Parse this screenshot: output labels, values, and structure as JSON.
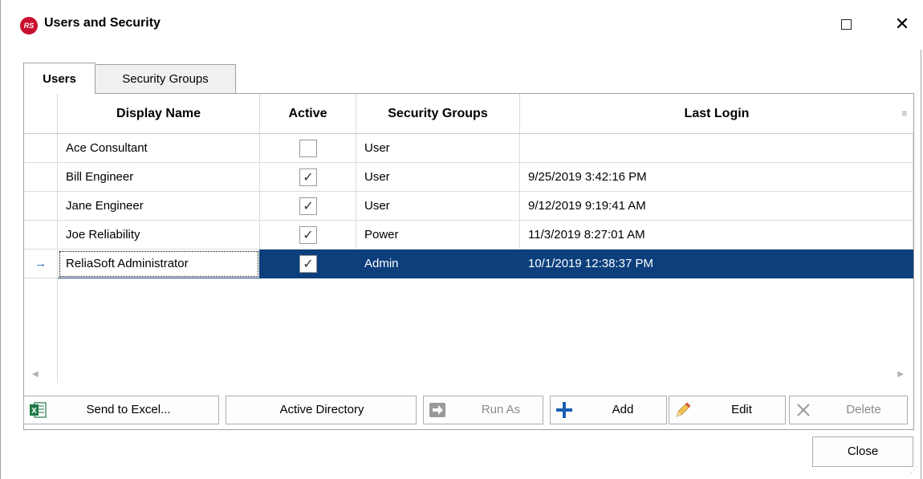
{
  "window": {
    "title": "Users and Security",
    "logo_text": "RS",
    "maximize_symbol": "",
    "close_symbol": "✕"
  },
  "tabs": [
    {
      "label": "Users",
      "active": true
    },
    {
      "label": "Security Groups",
      "active": false
    }
  ],
  "grid": {
    "columns": [
      "Display Name",
      "Active",
      "Security Groups",
      "Last Login"
    ],
    "rows": [
      {
        "display_name": "Ace Consultant",
        "active": false,
        "group": "User",
        "last_login": ""
      },
      {
        "display_name": "Bill Engineer",
        "active": true,
        "group": "User",
        "last_login": "9/25/2019 3:42:16 PM"
      },
      {
        "display_name": "Jane Engineer",
        "active": true,
        "group": "User",
        "last_login": "9/12/2019 9:19:41 AM"
      },
      {
        "display_name": "Joe Reliability",
        "active": true,
        "group": "Power",
        "last_login": "11/3/2019 8:27:01 AM"
      },
      {
        "display_name": "ReliaSoft Administrator",
        "active": true,
        "group": "Admin",
        "last_login": "10/1/2019 12:38:37 PM",
        "selected": true
      }
    ],
    "row_indicator": "→",
    "check_mark": "✓",
    "sort_icon": "≡",
    "scroll_left": "◀",
    "scroll_right": "▶"
  },
  "buttons": {
    "send_to_excel": "Send to Excel...",
    "active_directory": "Active Directory",
    "run_as": "Run As",
    "add": "Add",
    "edit": "Edit",
    "delete": "Delete",
    "close": "Close"
  },
  "colors": {
    "selection": "#0c3f7c",
    "brand": "#c8102e",
    "excel": "#1d7a45",
    "add_icon": "#1a5fb4"
  }
}
